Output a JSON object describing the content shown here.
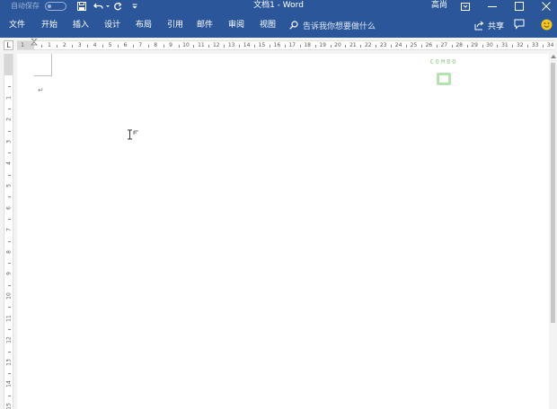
{
  "window": {
    "autosave_label": "自动保存",
    "title": "文档1  -  Word",
    "user": "高尚",
    "accent": "#2b579a"
  },
  "qat": {
    "save_icon": "save-icon",
    "undo_icon": "undo-icon",
    "redo_icon": "redo-icon",
    "customize_icon": "dropdown-icon"
  },
  "ribbon": {
    "tabs": [
      "文件",
      "开始",
      "插入",
      "设计",
      "布局",
      "引用",
      "邮件",
      "审阅",
      "视图"
    ],
    "tellme": "告诉我你想要做什么",
    "share": "共享"
  },
  "ruler": {
    "tab_selector": "L",
    "labels": [
      "1",
      "1",
      "2",
      "3",
      "4",
      "5",
      "6",
      "7",
      "8",
      "9",
      "10",
      "11",
      "12",
      "13",
      "14",
      "15",
      "16",
      "17",
      "18",
      "19",
      "20",
      "21",
      "22",
      "23",
      "24",
      "25",
      "26",
      "27",
      "28",
      "29",
      "30",
      "31",
      "32",
      "33",
      "34"
    ],
    "vlabels": [
      "1",
      "2",
      "3",
      "4",
      "5",
      "6",
      "7",
      "8",
      "9",
      "10",
      "11",
      "12",
      "13",
      "14",
      "15"
    ]
  },
  "document": {
    "paragraph_mark": "↵"
  },
  "watermark": {
    "text": "COMBO",
    "color": "#a9dca5"
  }
}
